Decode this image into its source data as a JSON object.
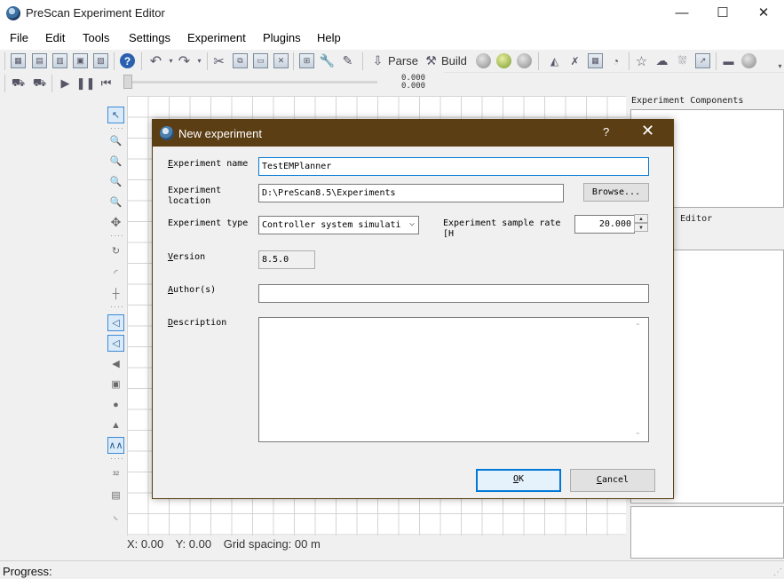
{
  "window": {
    "title": "PreScan Experiment Editor",
    "min": "—",
    "max": "☐",
    "close": "✕"
  },
  "menu": [
    "File",
    "Edit",
    "Tools",
    "Settings",
    "Experiment",
    "Plugins",
    "Help"
  ],
  "toolbar": {
    "parse_label": "Parse",
    "build_label": "Build"
  },
  "playback": {
    "time_top": "0.000",
    "time_bottom": "0.000"
  },
  "right_panel": {
    "components_title": "Experiment Components",
    "editor_label": "Editor"
  },
  "canvas_status": {
    "x": "X: 0.00",
    "y": "Y: 0.00",
    "grid": "Grid spacing: 00 m"
  },
  "status": {
    "progress_label": "Progress:"
  },
  "dialog": {
    "title": "New experiment",
    "help": "?",
    "close": "✕",
    "name_label_key": "E",
    "name_label_rest": "xperiment name",
    "name_value": "TestEMPlanner",
    "location_label": "Experiment location",
    "location_value": "D:\\PreScan8.5\\Experiments",
    "browse_label": "Browse...",
    "type_label": "Experiment type",
    "type_value": "Controller system simulati",
    "rate_label": "Experiment sample rate [H",
    "rate_value": "20.000",
    "version_label_key": "V",
    "version_label_rest": "ersion",
    "version_value": "8.5.0",
    "author_label_key": "A",
    "author_label_rest": "uthor(s)",
    "author_value": "",
    "description_label_key": "D",
    "description_label_rest": "escription",
    "description_value": "",
    "ok_label_key": "O",
    "ok_label_rest": "K",
    "cancel_label_key": "C",
    "cancel_label_rest": "ancel"
  },
  "icons": [
    "app-globe-icon",
    "new-icon",
    "open-icon",
    "save-icon",
    "help-icon",
    "undo-icon",
    "redo-icon",
    "cut-icon",
    "copy-icon",
    "paste-icon",
    "parse-icon",
    "build-icon",
    "play-icon",
    "pause-icon",
    "rewind-icon",
    "select-arrow-icon",
    "zoom-icon",
    "pan-icon"
  ]
}
